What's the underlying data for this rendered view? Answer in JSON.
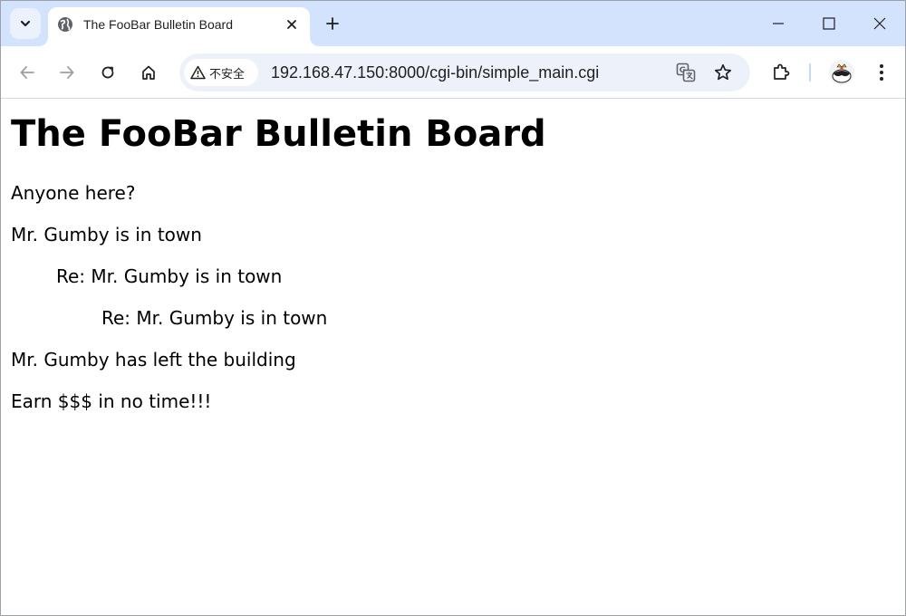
{
  "browser": {
    "tab": {
      "title": "The FooBar Bulletin Board"
    },
    "address_bar": {
      "security_label": "不安全",
      "url": "192.168.47.150:8000/cgi-bin/simple_main.cgi"
    }
  },
  "page": {
    "heading": "The FooBar Bulletin Board",
    "posts": [
      {
        "subject": "Anyone here?",
        "depth": 0
      },
      {
        "subject": "Mr. Gumby is in town",
        "depth": 0
      },
      {
        "subject": "Re: Mr. Gumby is in town",
        "depth": 1
      },
      {
        "subject": "Re: Mr. Gumby is in town",
        "depth": 2
      },
      {
        "subject": "Mr. Gumby has left the building",
        "depth": 0
      },
      {
        "subject": "Earn $$$ in no time!!!",
        "depth": 0
      }
    ]
  },
  "icons": {
    "tab_search": "chevron-down-icon",
    "favicon": "globe-icon",
    "tab_close": "close-icon",
    "new_tab": "plus-icon",
    "minimize": "minimize-icon",
    "maximize": "maximize-icon",
    "close_window": "close-icon",
    "back": "arrow-left-icon",
    "forward": "arrow-right-icon",
    "reload": "reload-icon",
    "home": "home-icon",
    "warning": "warning-icon",
    "translate": "translate-icon",
    "bookmark": "star-icon",
    "extensions": "puzzle-icon",
    "menu": "more-vertical-icon"
  },
  "colors": {
    "tab_strip": "#d3e3fd",
    "omnibox": "#edf2fa",
    "text": "#1f1f1f"
  }
}
